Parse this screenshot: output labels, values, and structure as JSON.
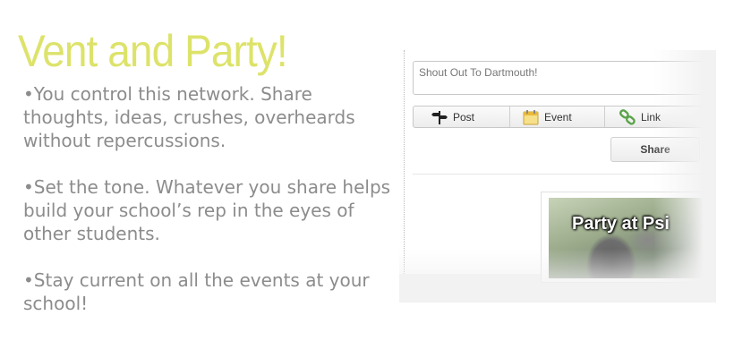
{
  "headline": "Vent and Party!",
  "bullets": [
    "•You control this network. Share thoughts, ideas, crushes, overheards without repercussions.",
    "•Set the tone.  Whatever you share helps build your school’s rep in the eyes of other students.",
    "•Stay current on all the events at your school!"
  ],
  "composer": {
    "placeholder": "Shout Out To Dartmouth!",
    "tabs": [
      {
        "label": "Post",
        "icon": "signpost-icon"
      },
      {
        "label": "Event",
        "icon": "calendar-icon"
      },
      {
        "label": "Link",
        "icon": "chain-link-icon"
      }
    ],
    "share_label": "Share"
  },
  "feed": {
    "card_title": "Party at Psi"
  },
  "colors": {
    "headline": "#dde36a",
    "body_text": "#8c8c8c"
  }
}
